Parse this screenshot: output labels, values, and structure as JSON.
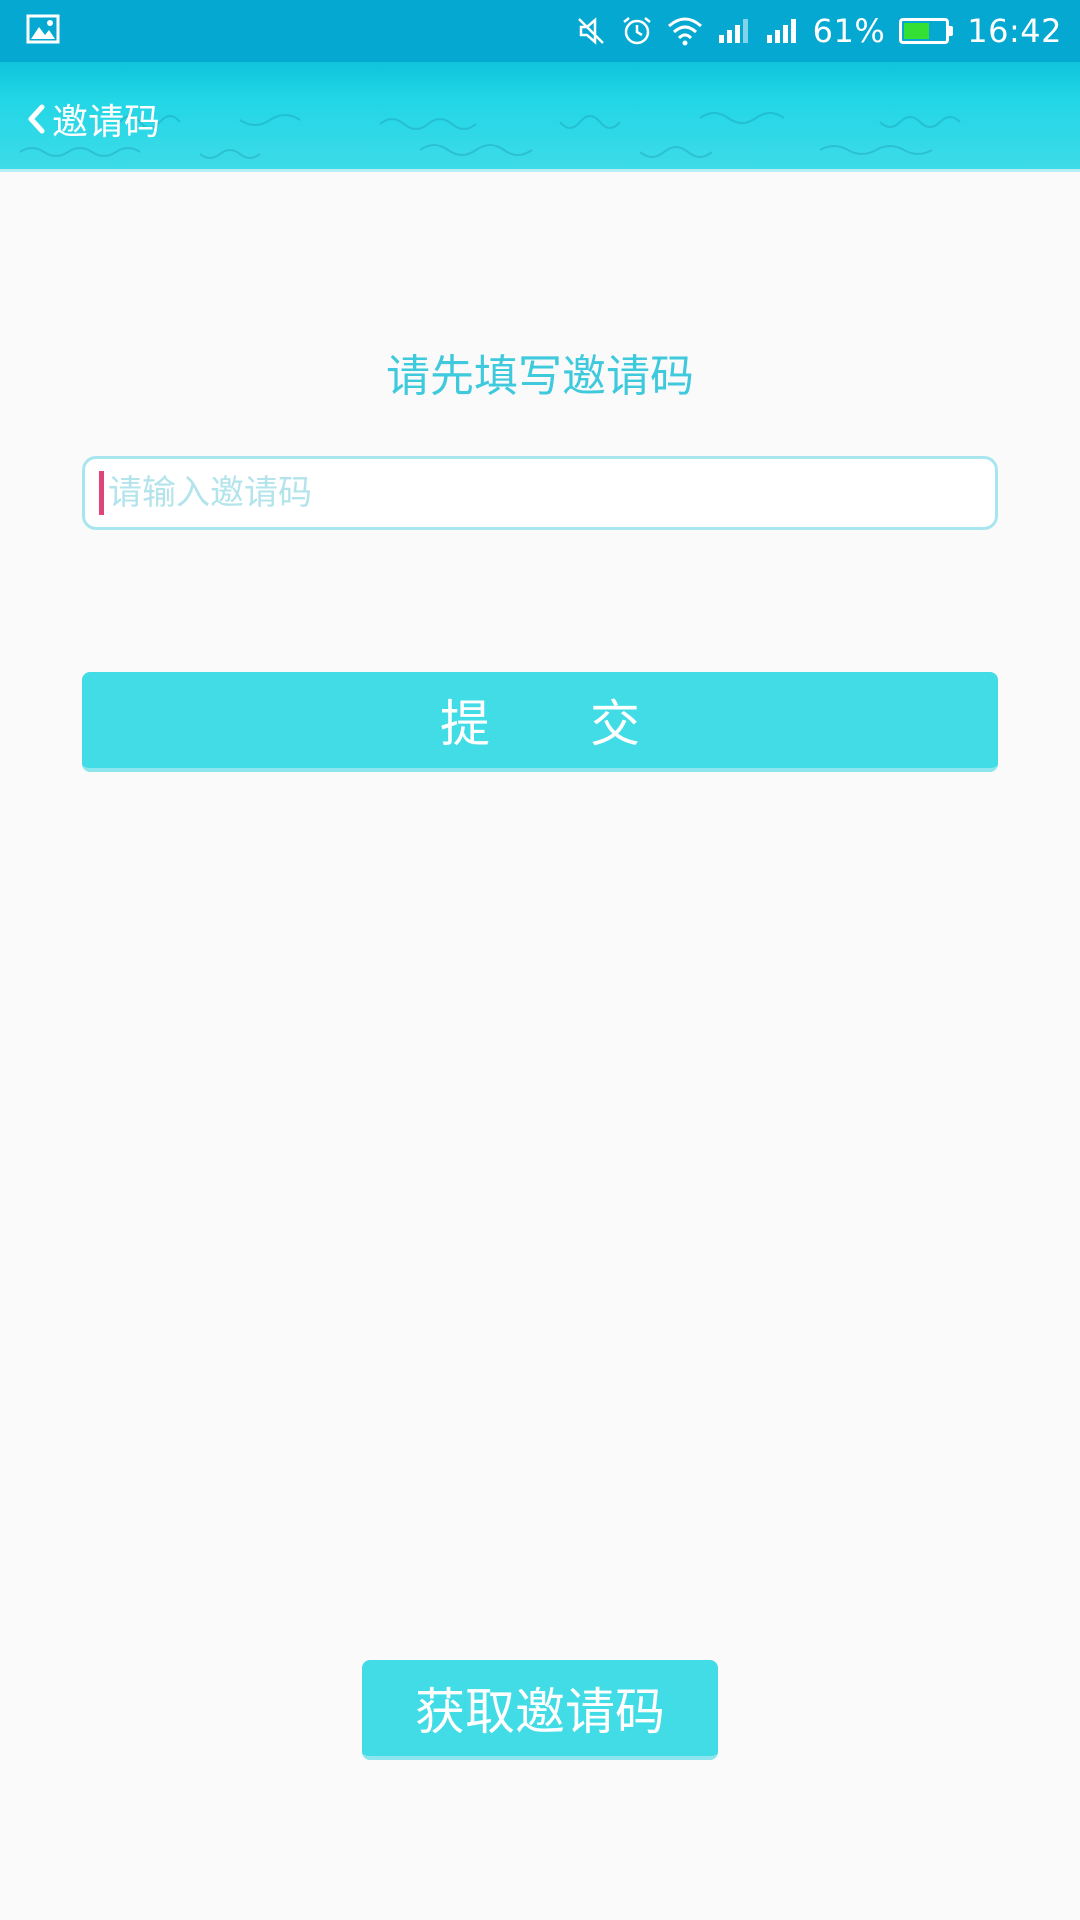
{
  "status_bar": {
    "left_icon": "image-notification-icon",
    "icons": [
      "mute-vibrate-icon",
      "alarm-icon",
      "wifi-icon",
      "signal-icon",
      "signal-icon"
    ],
    "battery_percent": "61%",
    "battery_level": 0.61,
    "time": "16:42"
  },
  "header": {
    "back_icon": "chevron-left-icon",
    "title": "邀请码"
  },
  "main": {
    "prompt": "请先填写邀请码",
    "invite_input": {
      "value": "",
      "placeholder": "请输入邀请码"
    },
    "submit_label": "提交",
    "get_code_label": "获取邀请码"
  },
  "colors": {
    "status_bar": "#04a8d0",
    "accent": "#42dce6",
    "prompt_text": "#3ec9dc",
    "caret": "#e0457a"
  }
}
